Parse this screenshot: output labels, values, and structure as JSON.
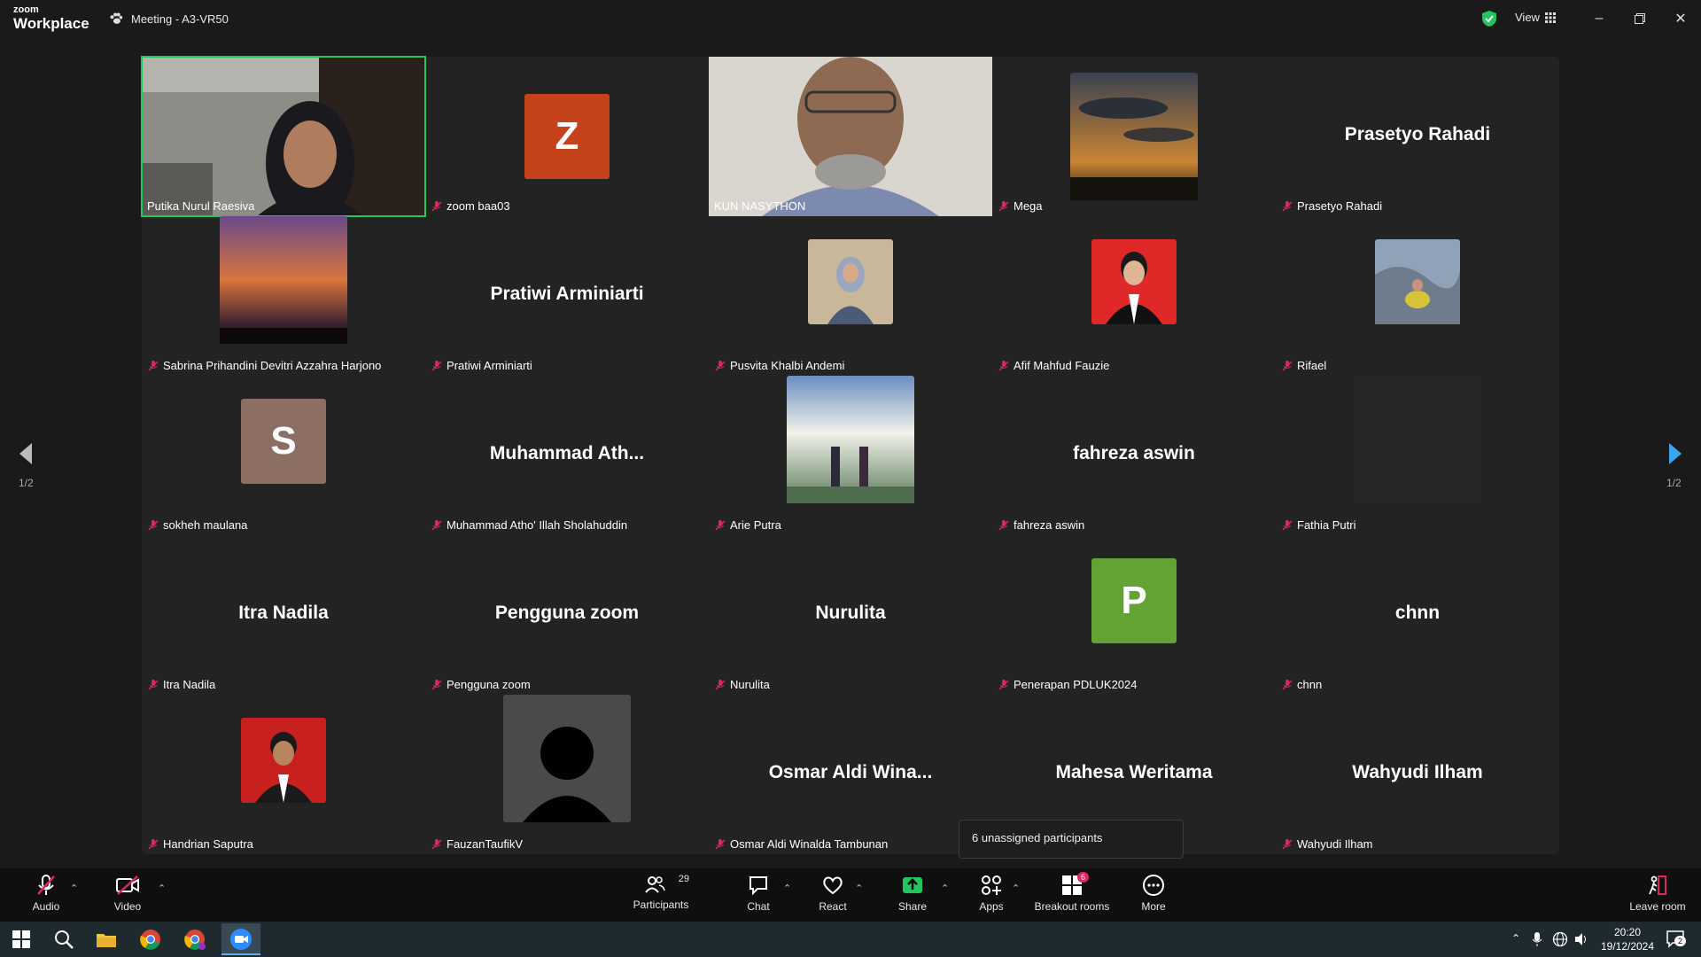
{
  "app": {
    "logo_small": "zoom",
    "logo_big": "Workplace",
    "meeting_title": "Meeting - A3-VR50",
    "view_label": "View"
  },
  "colors": {
    "active_border": "#22c55e",
    "stage": "#232323",
    "toolbar": "#0f0f0f",
    "share_green": "#22c55e"
  },
  "navigation": {
    "page_left": "1/2",
    "page_right": "1/2"
  },
  "participants": [
    {
      "name": "Putika Nurul Raesiva",
      "type": "video",
      "active": true
    },
    {
      "name": "zoom baa03",
      "type": "letter",
      "letter": "Z",
      "color": "#c5421b"
    },
    {
      "name": "KUN NASYTHON",
      "type": "video"
    },
    {
      "name": "Mega",
      "type": "photo"
    },
    {
      "name": "Prasetyo Rahadi",
      "type": "text",
      "display": "Prasetyo Rahadi"
    },
    {
      "name": "Sabrina Prihandini Devitri Azzahra Harjono",
      "type": "photo"
    },
    {
      "name": "Pratiwi Arminiarti",
      "type": "text",
      "display": "Pratiwi Arminiarti"
    },
    {
      "name": "Pusvita Khalbi Andemi",
      "type": "photo"
    },
    {
      "name": "Afif Mahfud Fauzie",
      "type": "photo"
    },
    {
      "name": "Rifael",
      "type": "photo"
    },
    {
      "name": "sokheh maulana",
      "type": "letter",
      "letter": "S",
      "color": "#8c6e64"
    },
    {
      "name": "Muhammad Atho' Illah Sholahuddin",
      "type": "text",
      "display": "Muhammad  Ath..."
    },
    {
      "name": "Arie Putra",
      "type": "photo"
    },
    {
      "name": "fahreza aswin",
      "type": "text",
      "display": "fahreza aswin"
    },
    {
      "name": "Fathia Putri",
      "type": "blank"
    },
    {
      "name": "Itra Nadila",
      "type": "text",
      "display": "Itra Nadila"
    },
    {
      "name": "Pengguna zoom",
      "type": "text",
      "display": "Pengguna zoom"
    },
    {
      "name": "Nurulita",
      "type": "text",
      "display": "Nurulita"
    },
    {
      "name": "Penerapan PDLUK2024",
      "type": "letter",
      "letter": "P",
      "color": "#63a334"
    },
    {
      "name": "chnn",
      "type": "text",
      "display": "chnn"
    },
    {
      "name": "Handrian Saputra",
      "type": "photo"
    },
    {
      "name": "FauzanTaufikV",
      "type": "silhouette"
    },
    {
      "name": "Osmar Aldi Winalda Tambunan",
      "type": "text",
      "display": "Osmar  Aldi  Wina..."
    },
    {
      "name": "Mahesa Weritama",
      "type": "text",
      "display": "Mahesa Weritama"
    },
    {
      "name": "Wahyudi Ilham",
      "type": "text",
      "display": "Wahyudi Ilham"
    }
  ],
  "tooltip": "6 unassigned participants",
  "toolbar": {
    "audio": "Audio",
    "video": "Video",
    "participants": "Participants",
    "participants_count": "29",
    "chat": "Chat",
    "react": "React",
    "share": "Share",
    "apps": "Apps",
    "breakout": "Breakout rooms",
    "breakout_badge": "6",
    "more": "More",
    "leave": "Leave room"
  },
  "taskbar": {
    "time": "20:20",
    "date": "19/12/2024",
    "notif_count": "2"
  }
}
